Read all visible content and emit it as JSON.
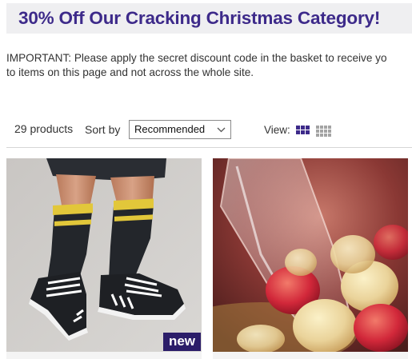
{
  "banner": {
    "title": "30% Off Our Cracking Christmas Category!"
  },
  "notice": {
    "line1": "IMPORTANT: Please apply the secret discount code in the basket to receive yo",
    "line2": "to items on this page and not across the whole site."
  },
  "toolbar": {
    "product_count": "29 products",
    "sort_label": "Sort by",
    "sort_selected": "Recommended",
    "view_label": "View:"
  },
  "products": [
    {
      "image_alt": "legs wearing black and yellow football socks and boot-style slippers",
      "badge": "new"
    },
    {
      "image_alt": "sugared fruit jellies spilling from a glass"
    }
  ],
  "colors": {
    "accent": "#3d2a8a",
    "badge": "#2b1d69",
    "banner_bg": "#efeff1"
  }
}
